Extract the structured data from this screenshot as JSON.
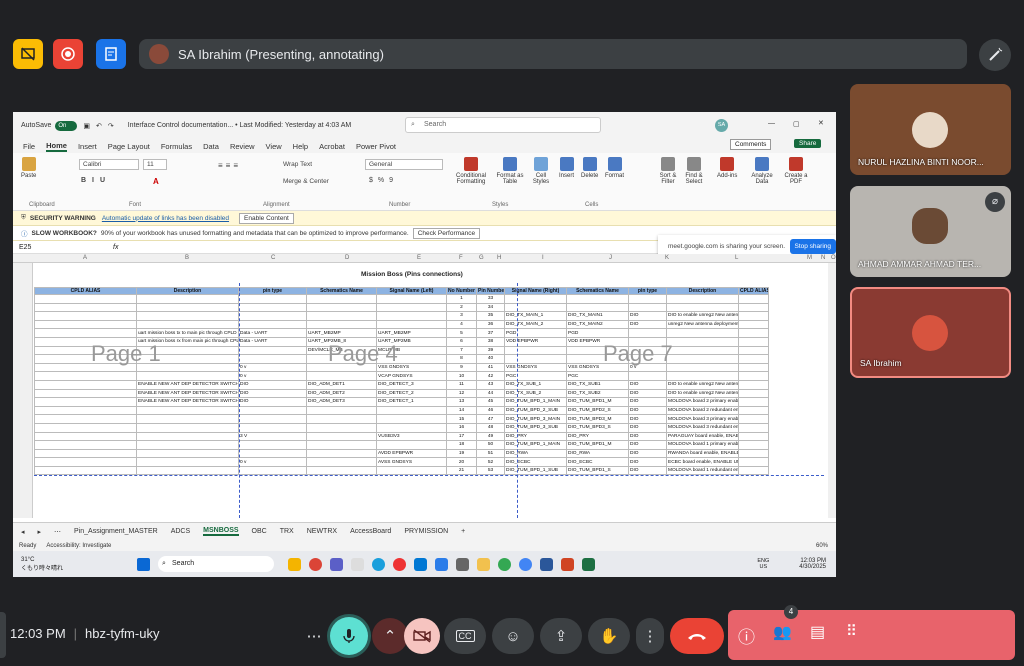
{
  "top": {
    "presenter": "SA Ibrahim (Presenting, annotating)"
  },
  "excel": {
    "autosave_label": "AutoSave",
    "autosave_state": "On",
    "doc_title": "Interface Control documentation... • Last Modified: Yesterday at 4:03 AM",
    "search_placeholder": "Search",
    "user_initials": "SA",
    "menu": [
      "File",
      "Home",
      "Insert",
      "Page Layout",
      "Formulas",
      "Data",
      "Review",
      "View",
      "Help",
      "Acrobat",
      "Power Pivot"
    ],
    "comments_label": "Comments",
    "share_label": "Share",
    "ribbon": {
      "paste": "Paste",
      "font_name": "Calibri",
      "font_size": "11",
      "wrap_text": "Wrap Text",
      "merge_center": "Merge & Center",
      "number_format": "General",
      "conditional": "Conditional Formatting",
      "format_table": "Format as Table",
      "cell_styles": "Cell Styles",
      "insert": "Insert",
      "delete": "Delete",
      "format": "Format",
      "sort_filter": "Sort & Filter",
      "find_select": "Find & Select",
      "addins": "Add-ins",
      "analyze": "Analyze Data",
      "create_pdf": "Create a PDF",
      "groups": [
        "Clipboard",
        "Font",
        "Alignment",
        "Number",
        "Styles",
        "Cells"
      ]
    },
    "share_popup": {
      "text": "meet.google.com is sharing your screen.",
      "stop": "Stop sharing"
    },
    "security_warning": {
      "label": "SECURITY WARNING",
      "text": "Automatic update of links has been disabled",
      "button": "Enable Content"
    },
    "slow_warning": {
      "label": "SLOW WORKBOOK?",
      "text": "90% of your workbook has unused formatting and metadata that can be optimized to improve performance.",
      "button": "Check Performance"
    },
    "name_box": "E25",
    "fx": "fx",
    "columns": [
      "A",
      "B",
      "C",
      "D",
      "E",
      "F",
      "G",
      "H",
      "I",
      "J",
      "K",
      "L",
      "M",
      "N",
      "O"
    ],
    "sheet_title": "Mission Boss (Pins connections)",
    "headers": [
      "CPLD ALIAS",
      "Description",
      "pin type",
      "Schematics Name",
      "Signal Name (Left)",
      "No Number",
      "Pin Number",
      "Signal Name (Right)",
      "Schematics Name",
      "pin type",
      "Description",
      "CPLD ALIAS"
    ],
    "watermarks": [
      "Page 1",
      "Page 4",
      "Page 7"
    ],
    "rows": [
      [
        "",
        "",
        "",
        "",
        "",
        "1",
        "33",
        "",
        "",
        "",
        "",
        ""
      ],
      [
        "",
        "",
        "",
        "",
        "",
        "2",
        "34",
        "",
        "",
        "",
        "",
        ""
      ],
      [
        "",
        "",
        "",
        "",
        "",
        "3",
        "35",
        "DIO_TX_MAIN_1",
        "DIO_TX_MAIN1",
        "DIO",
        "DIO to enable unreg2 New antenna deployment switch main1",
        ""
      ],
      [
        "",
        "",
        "",
        "",
        "",
        "4",
        "36",
        "DIO_TX_MAIN_2",
        "DIO_TX_MAIN2",
        "DIO",
        "unreg2 New antenna deployment switch main2",
        ""
      ],
      [
        "",
        "uart mission boss tx to main pic through CPLD",
        "Data - UART",
        "UART_MB2MP",
        "UART_MB2MP",
        "5",
        "37",
        "PGD",
        "PGD",
        "",
        "",
        ""
      ],
      [
        "",
        "uart mission boss rx from main pic through CPLD",
        "Data - UART",
        "UART_MP2MB_8",
        "UART_MP2MB",
        "6",
        "38",
        "VDD EPBPWR",
        "VDD EPBPWR",
        "",
        "",
        ""
      ],
      [
        "",
        "",
        "",
        "DEV/MCLR_MB",
        "MCLR MB",
        "7",
        "39",
        "",
        "",
        "",
        "",
        ""
      ],
      [
        "",
        "",
        "",
        "",
        "",
        "8",
        "40",
        "",
        "",
        "",
        "",
        ""
      ],
      [
        "",
        "",
        "0 v",
        "",
        "VSS GNDSYS",
        "9",
        "41",
        "VSS GNDSYS",
        "VSS GNDSYS",
        "0 v",
        "",
        ""
      ],
      [
        "",
        "",
        "0 v",
        "",
        "VCAP GNDSYS",
        "10",
        "42",
        "PGC",
        "PGC",
        "",
        "",
        ""
      ],
      [
        "",
        "ENABLE NEW ANT DEP DETECTOR SWITCH",
        "DIO",
        "DIO_ADM_DET1",
        "DIO_DETECT_3",
        "11",
        "43",
        "DIO_TX_SUB_1",
        "DIO_TX_SUB1",
        "DIO",
        "DIO to enable unreg2 New antenna deployment switch redundancy 1",
        ""
      ],
      [
        "",
        "ENABLE NEW ANT DEP DETECTOR SWITCH",
        "DIO",
        "DIO_ADM_DET2",
        "DIO_DETECT_2",
        "12",
        "44",
        "DIO_TX_SUB_2",
        "DIO_TX_SUB2",
        "DIO",
        "DIO to enable unreg2 New antenna deployment switch redundancy 2",
        ""
      ],
      [
        "",
        "ENABLE NEW ANT DEP DETECTOR SWITCH",
        "DIO",
        "DIO_ADM_DET3",
        "DIO_DETECT_1",
        "13",
        "45",
        "DIO_TUM_BPD_1_MAIN",
        "DIO_TUM_BPD1_M",
        "DIO",
        "MOLDOVA board 2 primary enable, ENABLE 5V CCP'S TUM",
        ""
      ],
      [
        "",
        "",
        "",
        "",
        "",
        "14",
        "46",
        "DIO_TUM_BPD_2_SUB",
        "DIO_TUM_BPD2_S",
        "DIO",
        "MOLDOVA board 2 redundant enable, ENABLE 5V CCP'S TUM",
        ""
      ],
      [
        "",
        "",
        "",
        "",
        "",
        "15",
        "47",
        "DIO_TUM_BPD_3_MAIN",
        "DIO_TUM_BPD3_M",
        "DIO",
        "MOLDOVA board 3 primary enable, ENABLE 5V CCP'S TUM",
        ""
      ],
      [
        "",
        "",
        "",
        "",
        "",
        "16",
        "48",
        "DIO_TUM_BPD_3_SUB",
        "DIO_TUM_BPD3_S",
        "DIO",
        "MOLDOVA board 3 redundant enable, ENABLE 5V CCP'S TUM",
        ""
      ],
      [
        "",
        "",
        "3 V",
        "",
        "VUSB3V3",
        "17",
        "49",
        "DIO_PRY",
        "DIO_PRY",
        "DIO",
        "PARAGUAY board enable, ENABLE 3V3S",
        ""
      ],
      [
        "",
        "",
        "",
        "",
        "",
        "18",
        "50",
        "DIO_TUM_BPD_1_MAIN",
        "DIO_TUM_BPD1_M",
        "DIO",
        "MOLDOVA board 1 primary enable, ENABLE 5V CCP'S TUM",
        ""
      ],
      [
        "",
        "",
        "",
        "",
        "AVDD EPBPWR",
        "19",
        "51",
        "DIO_RWA",
        "DIO_RWA",
        "DIO",
        "RWANDA board enable, ENABLE 12V CCP'S DSIL",
        ""
      ],
      [
        "",
        "",
        "0 v",
        "",
        "AVSS GNDSYS",
        "20",
        "52",
        "DIO_ECBC",
        "DIO_ECBC",
        "DIO",
        "ECBC board enable, ENABLE UNREG3 CCP'S ECBC",
        ""
      ],
      [
        "",
        "",
        "",
        "",
        "",
        "21",
        "53",
        "DIO_TUM_BPD_1_SUB",
        "DIO_TUM_BPD1_S",
        "DIO",
        "MOLDOVA board 1 redundant enable, ENABLE 5V CCP'S TUM",
        ""
      ]
    ],
    "tabs": [
      "Pin_Assignment_MASTER",
      "ADCS",
      "MSNBOSS",
      "OBC",
      "TRX",
      "NEWTRX",
      "AccessBoard",
      "PRYMISSION"
    ],
    "active_tab": "MSNBOSS",
    "status_ready": "Ready",
    "status_access": "Accessibility: Investigate",
    "zoom": "60%",
    "taskbar": {
      "weather_temp": "31°C",
      "weather_desc": "くもり時々晴れ",
      "search": "Search",
      "lang": "ENG",
      "region": "US",
      "time": "12:03 PM",
      "date": "4/30/2025"
    }
  },
  "participants": [
    {
      "name": "NURUL HAZLINA BINTI NOOR..."
    },
    {
      "name": "AHMAD AMMAR AHMAD TER..."
    },
    {
      "name": "SA Ibrahim"
    }
  ],
  "bottom": {
    "time": "12:03 PM",
    "meeting_code": "hbz-tyfm-uky",
    "participant_count": "4"
  },
  "colors": {
    "bg": "#202124",
    "excel_green": "#166a3e",
    "end_call": "#e8636b",
    "mic_active": "#5de0d2"
  }
}
